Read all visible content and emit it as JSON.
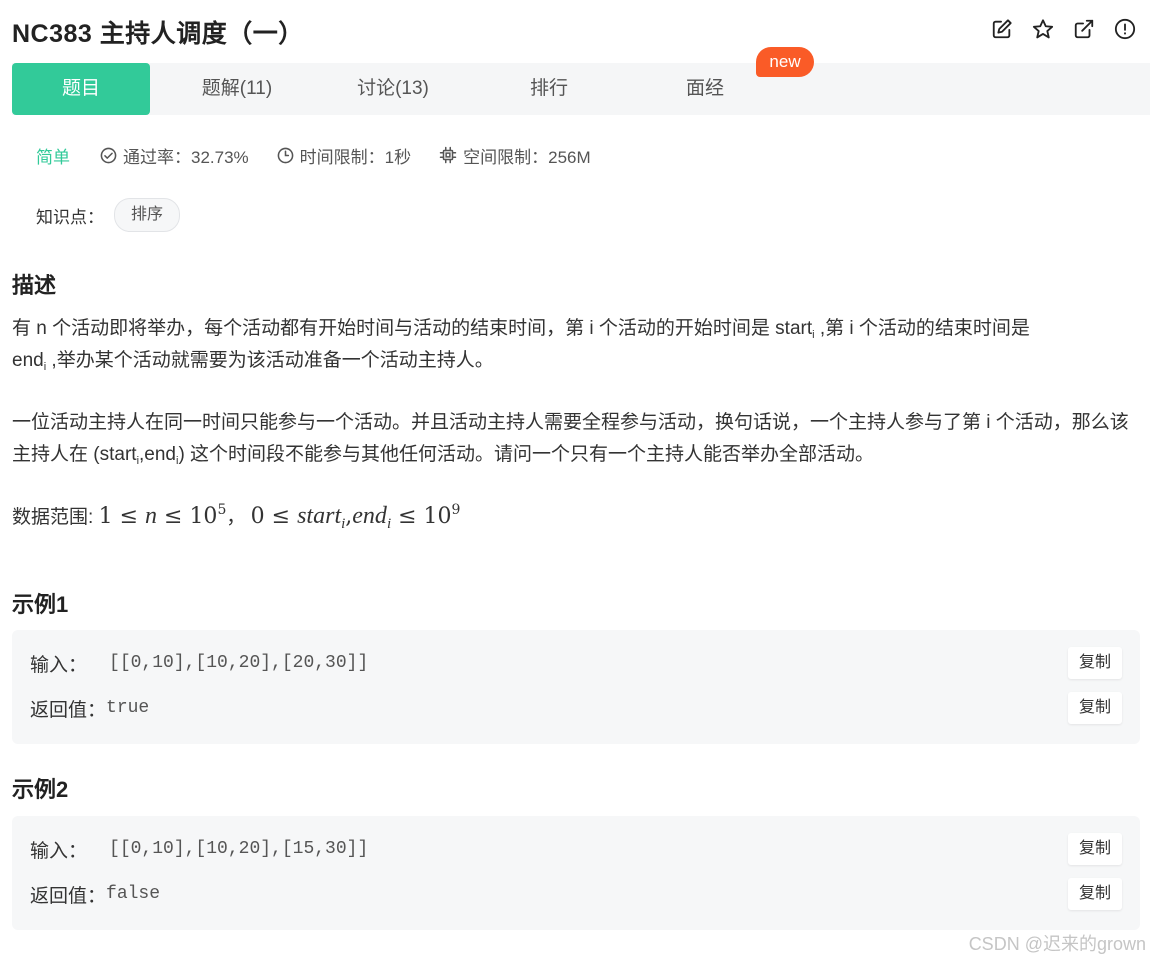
{
  "problem": {
    "title": "NC383  主持人调度（一）"
  },
  "header_icons": [
    "edit-icon",
    "star-icon",
    "share-icon",
    "report-icon"
  ],
  "tabs": [
    {
      "label": "题目",
      "active": true
    },
    {
      "label": "题解(11)"
    },
    {
      "label": "讨论(13)"
    },
    {
      "label": "排行"
    },
    {
      "label": "面经"
    }
  ],
  "new_badge": "new",
  "meta": {
    "difficulty": "简单",
    "pass_rate": "通过率：32.73%",
    "time_limit": "时间限制：1秒",
    "space_limit": "空间限制：256M"
  },
  "knowledge": {
    "label": "知识点：",
    "tag": "排序"
  },
  "description": {
    "heading": "描述",
    "p1": {
      "a": "有 n 个活动即将举办，每个活动都有开始时间与活动的结束时间，第 i 个活动的开始时间是 start",
      "a_sub": "i",
      "b": " ,第 i 个活动的结束时间是",
      "c": "end",
      "c_sub": "i",
      "d": " ,举办某个活动就需要为该活动准备一个活动主持人。"
    },
    "p2": {
      "a": "一位活动主持人在同一时间只能参与一个活动。并且活动主持人需要全程参与活动，换句话说，一个主持人参与了第 i 个活动，那么该主持人在 (start",
      "a_sub": "i",
      "b": ",end",
      "b_sub": "i",
      "c": ") 这个时间段不能参与其他任何活动。请问一个只有一个主持人能否举办全部活动。"
    },
    "range": {
      "label": "数据范围:",
      "m1": "1",
      "le": "≤",
      "n": "n",
      "ten": "10",
      "exp5": "5",
      "sep": "，",
      "zero": "0",
      "start": "start",
      "i": "i",
      "comma": ",",
      "end": "end",
      "exp9": "9"
    }
  },
  "examples": [
    {
      "heading": "示例1",
      "input_label": "输入：",
      "input": "[[0,10],[10,20],[20,30]]",
      "output_label": "返回值：",
      "output": "true",
      "copy_label": "复制"
    },
    {
      "heading": "示例2",
      "input_label": "输入：",
      "input": "[[0,10],[10,20],[15,30]]",
      "output_label": "返回值：",
      "output": "false",
      "copy_label": "复制"
    }
  ],
  "watermark": "CSDN @迟来的grown",
  "colors": {
    "accent": "#32ca99",
    "badge": "#fa5b27",
    "tab_bg": "#f5f6f7",
    "example_bg": "#f6f7f8"
  }
}
